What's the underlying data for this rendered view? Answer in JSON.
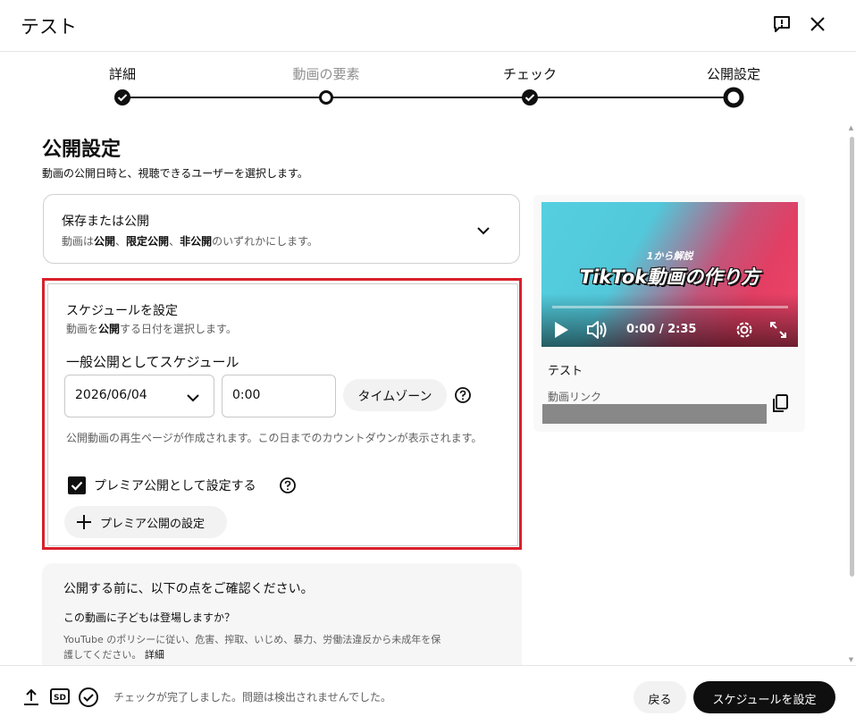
{
  "header": {
    "title": "テスト"
  },
  "stepper": {
    "steps": [
      {
        "label": "詳細",
        "state": "done"
      },
      {
        "label": "動画の要素",
        "state": "skipped"
      },
      {
        "label": "チェック",
        "state": "done"
      },
      {
        "label": "公開設定",
        "state": "current"
      }
    ]
  },
  "visibility": {
    "title": "公開設定",
    "subtitle": "動画の公開日時と、視聴できるユーザーを選択します。",
    "save_or_publish": {
      "title": "保存または公開",
      "desc_prefix": "動画は",
      "public": "公開",
      "sep1": "、",
      "unlisted": "限定公開",
      "sep2": "、",
      "private": "非公開",
      "desc_suffix": "のいずれかにします。"
    },
    "schedule": {
      "title": "スケジュールを設定",
      "desc_prefix": "動画を",
      "desc_bold": "公開",
      "desc_suffix": "する日付を選択します。",
      "heading": "一般公開としてスケジュール",
      "date_value": "2026/06/04",
      "time_value": "0:00",
      "timezone_label": "タイムゾーン",
      "note": "公開動画の再生ページが作成されます。この日までのカウントダウンが表示されます。",
      "premiere_checkbox_label": "プレミア公開として設定する",
      "premiere_checked": true,
      "premiere_settings_label": "プレミア公開の設定"
    },
    "confirm": {
      "title": "公開する前に、以下の点をご確認ください。",
      "question": "この動画に子どもは登場しますか？",
      "policy": "YouTube のポリシーに従い、危害、搾取、いじめ、暴力、労働法違反から未成年を保護してください。",
      "details_link": "詳細"
    }
  },
  "preview": {
    "overlay_small": "1から解説",
    "overlay_big": "TikTok動画の作り方",
    "time": "0:00 / 2:35",
    "video_title": "テスト",
    "link_label": "動画リンク",
    "colors": {
      "cyan": "#54d0e0",
      "pink": "#f0466a"
    }
  },
  "footer": {
    "status": "チェックが完了しました。問題は検出されませんでした。",
    "back_label": "戻る",
    "schedule_label": "スケジュールを設定"
  },
  "colors": {
    "highlight_border": "#d9202b",
    "primary_button": "#0f0f0f"
  }
}
